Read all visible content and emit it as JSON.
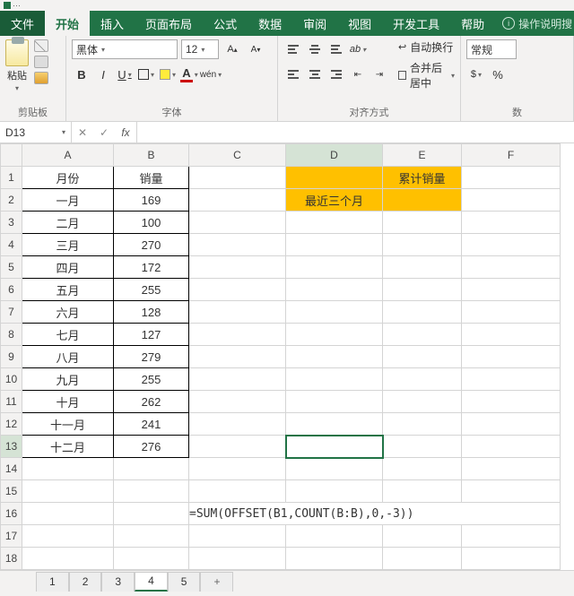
{
  "titlebar": {
    "icon": "excel-icon"
  },
  "tabs": {
    "file": "文件",
    "items": [
      "开始",
      "插入",
      "页面布局",
      "公式",
      "数据",
      "审阅",
      "视图",
      "开发工具",
      "帮助"
    ],
    "active": 0,
    "tell": "操作说明搜"
  },
  "ribbon": {
    "clipboard": {
      "paste": "粘贴",
      "group": "剪贴板"
    },
    "font": {
      "name": "黑体",
      "size": "12",
      "bold": "B",
      "italic": "I",
      "underline": "U",
      "font_a": "A",
      "wen": "wén",
      "group": "字体"
    },
    "align": {
      "wrap": "自动换行",
      "merge": "合并后居中",
      "group": "对齐方式"
    },
    "number": {
      "format": "常规",
      "group": "数"
    }
  },
  "formula_bar": {
    "namebox": "D13",
    "cancel": "✕",
    "enter": "✓",
    "fx": "fx",
    "formula": ""
  },
  "sheet": {
    "cols": [
      "A",
      "B",
      "C",
      "D",
      "E",
      "F"
    ],
    "rows": [
      "1",
      "2",
      "3",
      "4",
      "5",
      "6",
      "7",
      "8",
      "9",
      "10",
      "11",
      "12",
      "13",
      "14",
      "15",
      "16",
      "17",
      "18"
    ],
    "headerA": "月份",
    "headerB": "销量",
    "months": [
      "一月",
      "二月",
      "三月",
      "四月",
      "五月",
      "六月",
      "七月",
      "八月",
      "九月",
      "十月",
      "十一月",
      "十二月"
    ],
    "values": [
      "169",
      "100",
      "270",
      "172",
      "255",
      "128",
      "127",
      "279",
      "255",
      "262",
      "241",
      "276"
    ],
    "d2": "最近三个月",
    "e1": "累计销量",
    "formula16": "=SUM(OFFSET(B1,COUNT(B:B),0,-3))",
    "active": "D13"
  },
  "sheet_tabs": {
    "tabs": [
      "1",
      "2",
      "3",
      "4",
      "5"
    ],
    "active": 3,
    "add": "+"
  }
}
